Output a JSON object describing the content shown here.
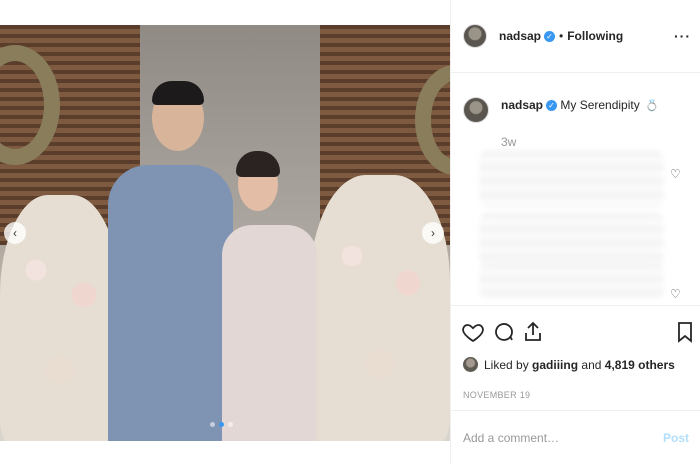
{
  "post": {
    "username": "nadsap",
    "follow_separator": "•",
    "follow_status": "Following",
    "more_icon": "more-dots-icon",
    "caption": "My Serendipity",
    "caption_emoji": "💍",
    "time_ago": "3w",
    "likes": {
      "prefix": "Liked by",
      "user": "gadiiing",
      "joiner": "and",
      "count_text": "4,819 others"
    },
    "date": "NOVEMBER 19",
    "comment_placeholder": "Add a comment…",
    "post_label": "Post",
    "carousel": {
      "dots_total": 3,
      "active_dot": 1
    }
  },
  "colors": {
    "verified": "#3897f0",
    "post_button": "#b2dffc",
    "muted_text": "#999999",
    "border": "#efefef"
  },
  "icons": [
    "heart-icon",
    "comment-icon",
    "share-icon",
    "bookmark-icon",
    "verified-badge-icon",
    "chevron-left-icon",
    "chevron-right-icon"
  ]
}
